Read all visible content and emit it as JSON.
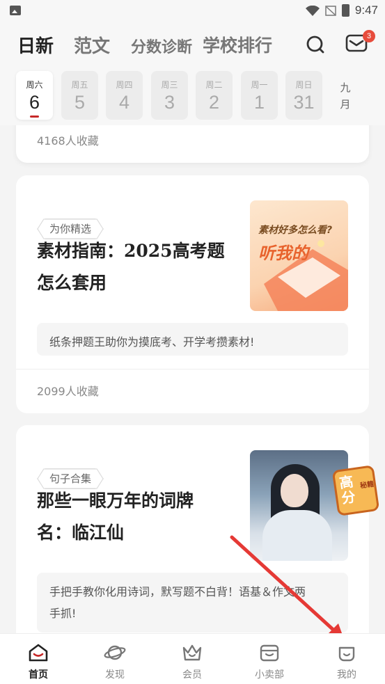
{
  "status_bar": {
    "time": "9:47"
  },
  "header": {
    "tabs": [
      {
        "label": "日新",
        "active": true
      },
      {
        "label": "范文",
        "active": false
      },
      {
        "label": "分数诊断",
        "active": false
      },
      {
        "label": "学校排行",
        "active": false
      }
    ],
    "mail_badge": "3"
  },
  "date_strip": {
    "days": [
      {
        "weekday": "周六",
        "date": "6",
        "active": true
      },
      {
        "weekday": "周五",
        "date": "5",
        "active": false
      },
      {
        "weekday": "周四",
        "date": "4",
        "active": false
      },
      {
        "weekday": "周三",
        "date": "3",
        "active": false
      },
      {
        "weekday": "周二",
        "date": "2",
        "active": false
      },
      {
        "weekday": "周一",
        "date": "1",
        "active": false
      },
      {
        "weekday": "周日",
        "date": "31",
        "active": false
      }
    ],
    "month": "九月"
  },
  "feed": {
    "top_card": {
      "favorites": "4168人收藏"
    },
    "cards": [
      {
        "tag": "为你精选",
        "title_line1": "素材指南：2025高考题",
        "title_line2": "怎么套用",
        "thumb_text1": "素材好多怎么看?",
        "thumb_text2": "听我的",
        "summary": "纸条押题王助你为摸底考、开学考攒素材!",
        "favorites": "2099人收藏"
      },
      {
        "tag": "句子合集",
        "title_line1": "那些一眼万年的词牌",
        "title_line2": "名：临江仙",
        "badge_text1": "高",
        "badge_text2": "分",
        "badge_text3": "秘籍",
        "summary_line1": "手把手教你化用诗词，默写题不白背！语基＆作文两",
        "summary_line2": "手抓!"
      }
    ]
  },
  "bottom_nav": {
    "items": [
      {
        "label": "首页",
        "icon": "home-icon",
        "active": true
      },
      {
        "label": "发现",
        "icon": "planet-icon",
        "active": false
      },
      {
        "label": "会员",
        "icon": "crown-icon",
        "active": false
      },
      {
        "label": "小卖部",
        "icon": "shop-icon",
        "active": false
      },
      {
        "label": "我的",
        "icon": "profile-icon",
        "active": false
      }
    ]
  },
  "colors": {
    "accent": "#c62828",
    "arrow": "#e53935",
    "badge": "#e74c3c"
  }
}
